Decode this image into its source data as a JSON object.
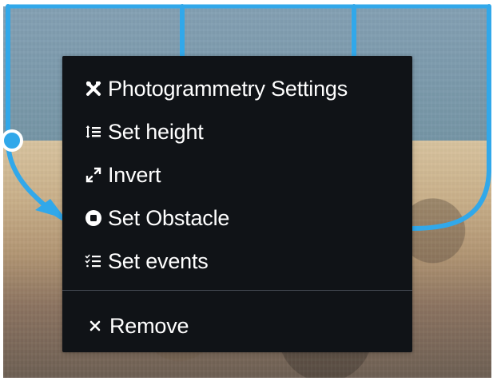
{
  "menu": {
    "items": [
      {
        "label": "Photogrammetry Settings",
        "icon": "tools-icon"
      },
      {
        "label": "Set height",
        "icon": "height-list-icon"
      },
      {
        "label": "Invert",
        "icon": "expand-arrows-icon"
      },
      {
        "label": "Set Obstacle",
        "icon": "circle-stop-icon"
      },
      {
        "label": "Set events",
        "icon": "checklist-icon"
      },
      {
        "label": "Remove",
        "icon": "close-icon"
      }
    ]
  },
  "colors": {
    "menu_background": "#101317",
    "menu_text": "#ffffff",
    "route_accent": "#31a8ea"
  }
}
